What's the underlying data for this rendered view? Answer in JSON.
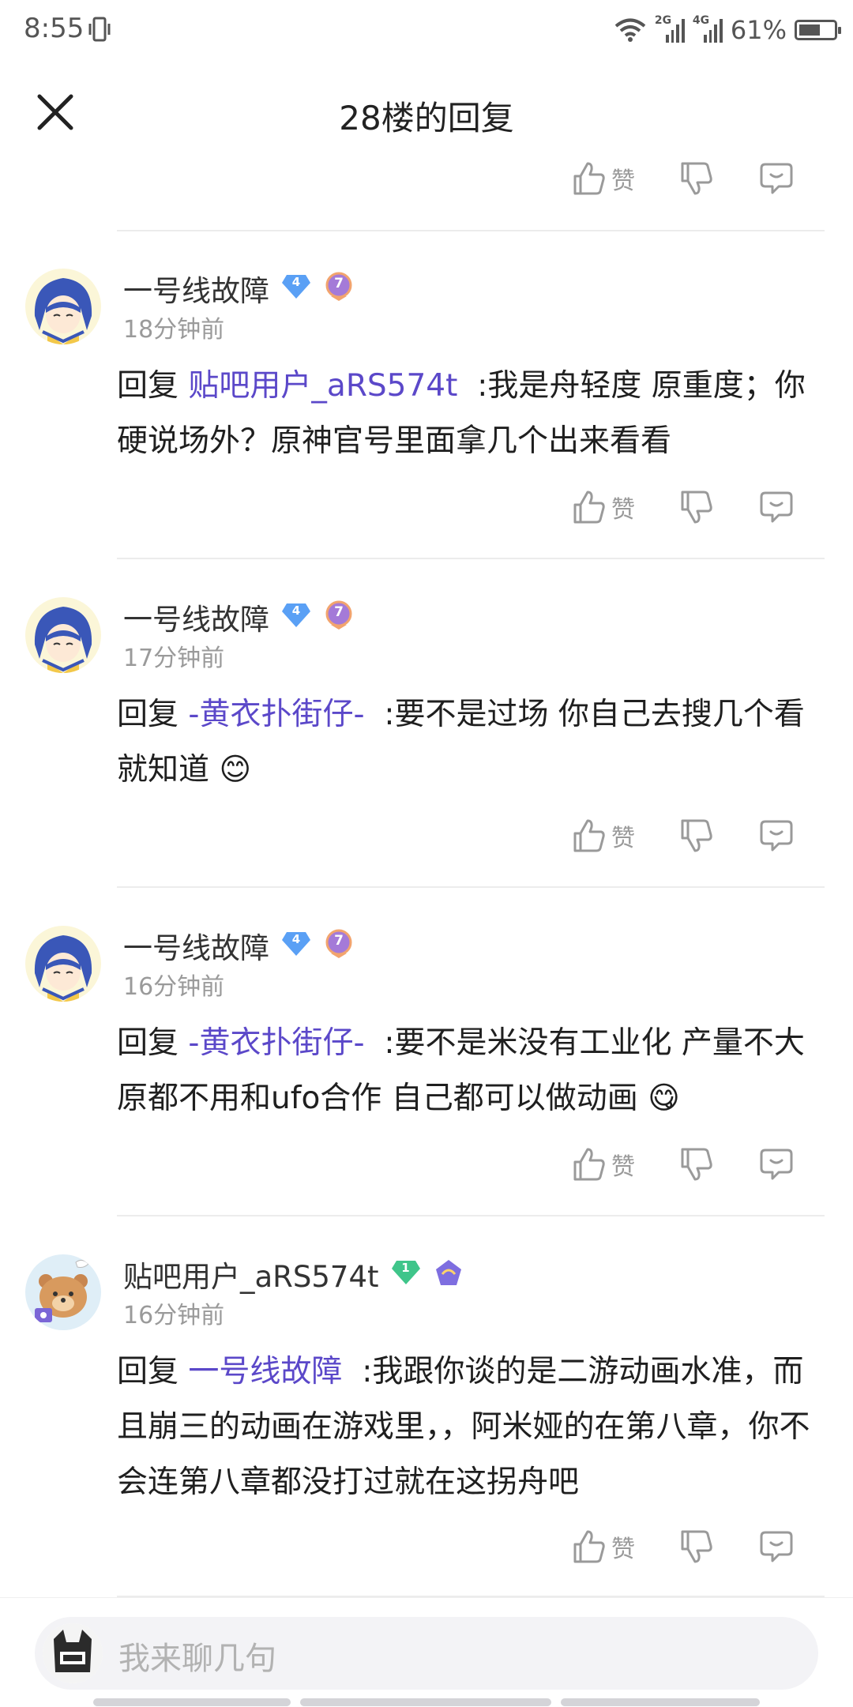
{
  "status": {
    "time": "8:55",
    "net1": "2G",
    "net2": "4G",
    "battery": "61%"
  },
  "battery_fraction": 0.61,
  "header": {
    "title": "28楼的回复"
  },
  "like_label": "赞",
  "comments": [
    {
      "username": "一号线故障",
      "level": "4",
      "badge": "7",
      "time": "18分钟前",
      "prefix": "回复",
      "mention": "贴吧用户_aRS574t",
      "text": ":我是舟轻度 原重度；你硬说场外？原神官号里面拿几个出来看看"
    },
    {
      "username": "一号线故障",
      "level": "4",
      "badge": "7",
      "time": "17分钟前",
      "prefix": "回复",
      "mention": "-黄衣扑街仔-",
      "text": ":要不是过场 你自己去搜几个看就知道",
      "emoji": "😊"
    },
    {
      "username": "一号线故障",
      "level": "4",
      "badge": "7",
      "time": "16分钟前",
      "prefix": "回复",
      "mention": "-黄衣扑街仔-",
      "text": ":要不是米没有工业化 产量不大 原都不用和ufo合作 自己都可以做动画",
      "emoji": "😋"
    },
    {
      "username": "贴吧用户_aRS574t",
      "level": "1",
      "badge": "",
      "time": "16分钟前",
      "prefix": "回复",
      "mention": "一号线故障",
      "text": ":我跟你谈的是二游动画水准，而且崩三的动画在游戏里，，阿米娅的在第八章，你不会连第八章都没打过就在这拐舟吧"
    }
  ],
  "input": {
    "placeholder": "我来聊几句"
  },
  "colors": {
    "mention": "#5b48c9",
    "level_blue": "#5aa0f5",
    "level_green": "#3fc58a",
    "badge_purple": "#a47ad8"
  }
}
